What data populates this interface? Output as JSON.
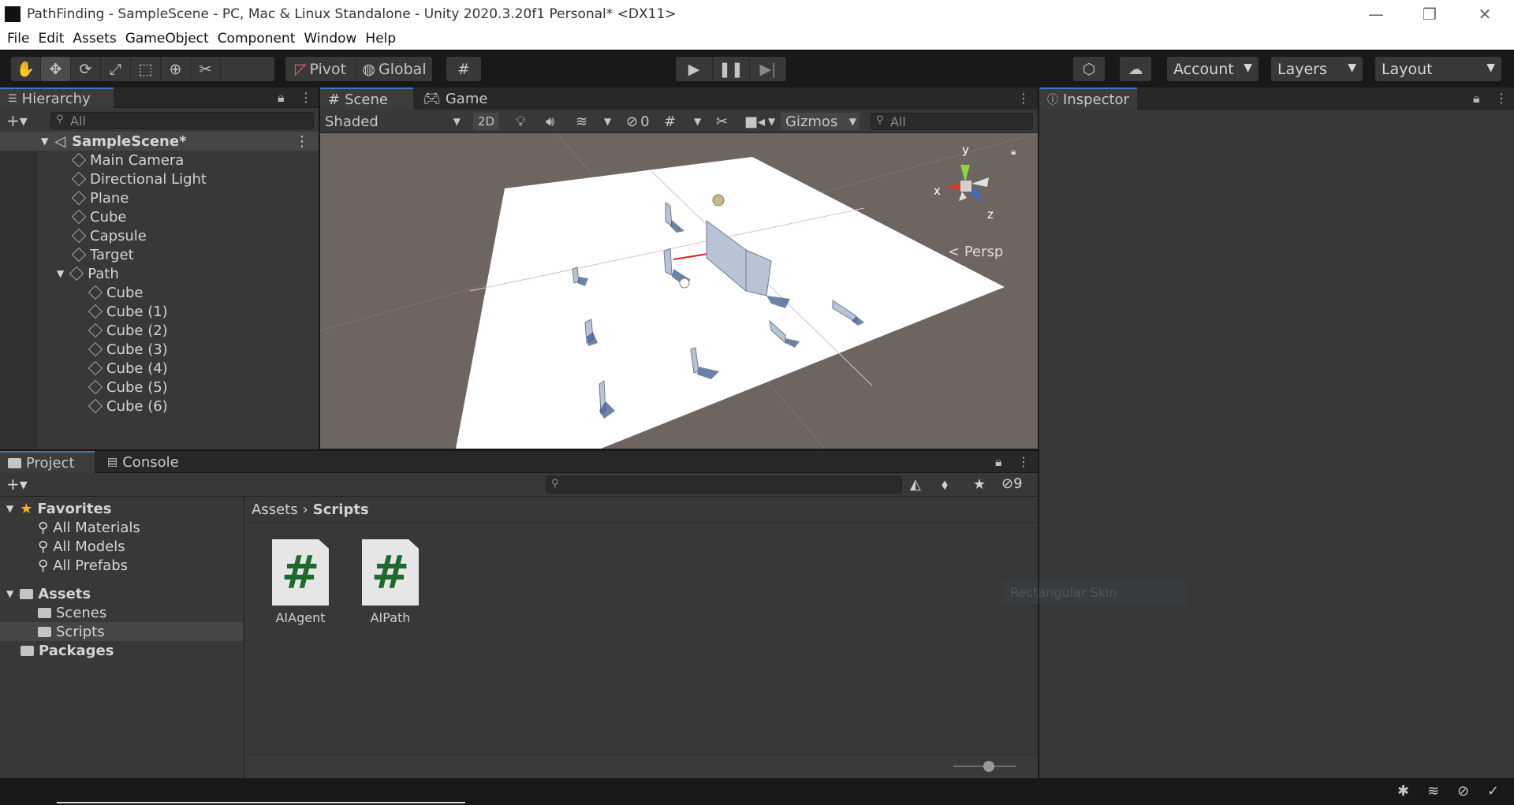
{
  "window": {
    "title": "PathFinding - SampleScene - PC, Mac & Linux Standalone - Unity 2020.3.20f1 Personal* <DX11>",
    "minimize": "—",
    "restore": "❐",
    "close": "✕"
  },
  "menu": [
    "File",
    "Edit",
    "Assets",
    "GameObject",
    "Component",
    "Window",
    "Help"
  ],
  "toolbar": {
    "pivot": "Pivot",
    "global": "Global",
    "account": "Account",
    "layers": "Layers",
    "layout": "Layout"
  },
  "hierarchy": {
    "tab": "Hierarchy",
    "search_placeholder": "All",
    "scene": "SampleScene*",
    "items": [
      "Main Camera",
      "Directional Light",
      "Plane",
      "Cube",
      "Capsule",
      "Target",
      "Path"
    ],
    "path_children": [
      "Cube",
      "Cube (1)",
      "Cube (2)",
      "Cube (3)",
      "Cube (4)",
      "Cube (5)",
      "Cube (6)"
    ]
  },
  "scene": {
    "tab_scene": "Scene",
    "tab_game": "Game",
    "shading": "Shaded",
    "mode_2d": "2D",
    "hidden_count": "0",
    "gizmos": "Gizmos",
    "search_placeholder": "All",
    "persp": "Persp",
    "axis_x": "x",
    "axis_y": "y",
    "axis_z": "z"
  },
  "inspector": {
    "tab": "Inspector"
  },
  "project": {
    "tab_project": "Project",
    "tab_console": "Console",
    "hidden_count": "9",
    "favorites": "Favorites",
    "fav_items": [
      "All Materials",
      "All Models",
      "All Prefabs"
    ],
    "assets": "Assets",
    "asset_folders": [
      "Scenes",
      "Scripts"
    ],
    "packages": "Packages",
    "breadcrumb_root": "Assets",
    "breadcrumb_current": "Scripts",
    "files": [
      "AIAgent",
      "AIPath"
    ],
    "file_glyph": "#"
  },
  "ghost_tooltip": "Rectangular Skin",
  "colors": {
    "accent": "#3a79bb",
    "panel": "#383838",
    "toolbar": "#191919",
    "csharp_green": "#1d6a2c"
  }
}
